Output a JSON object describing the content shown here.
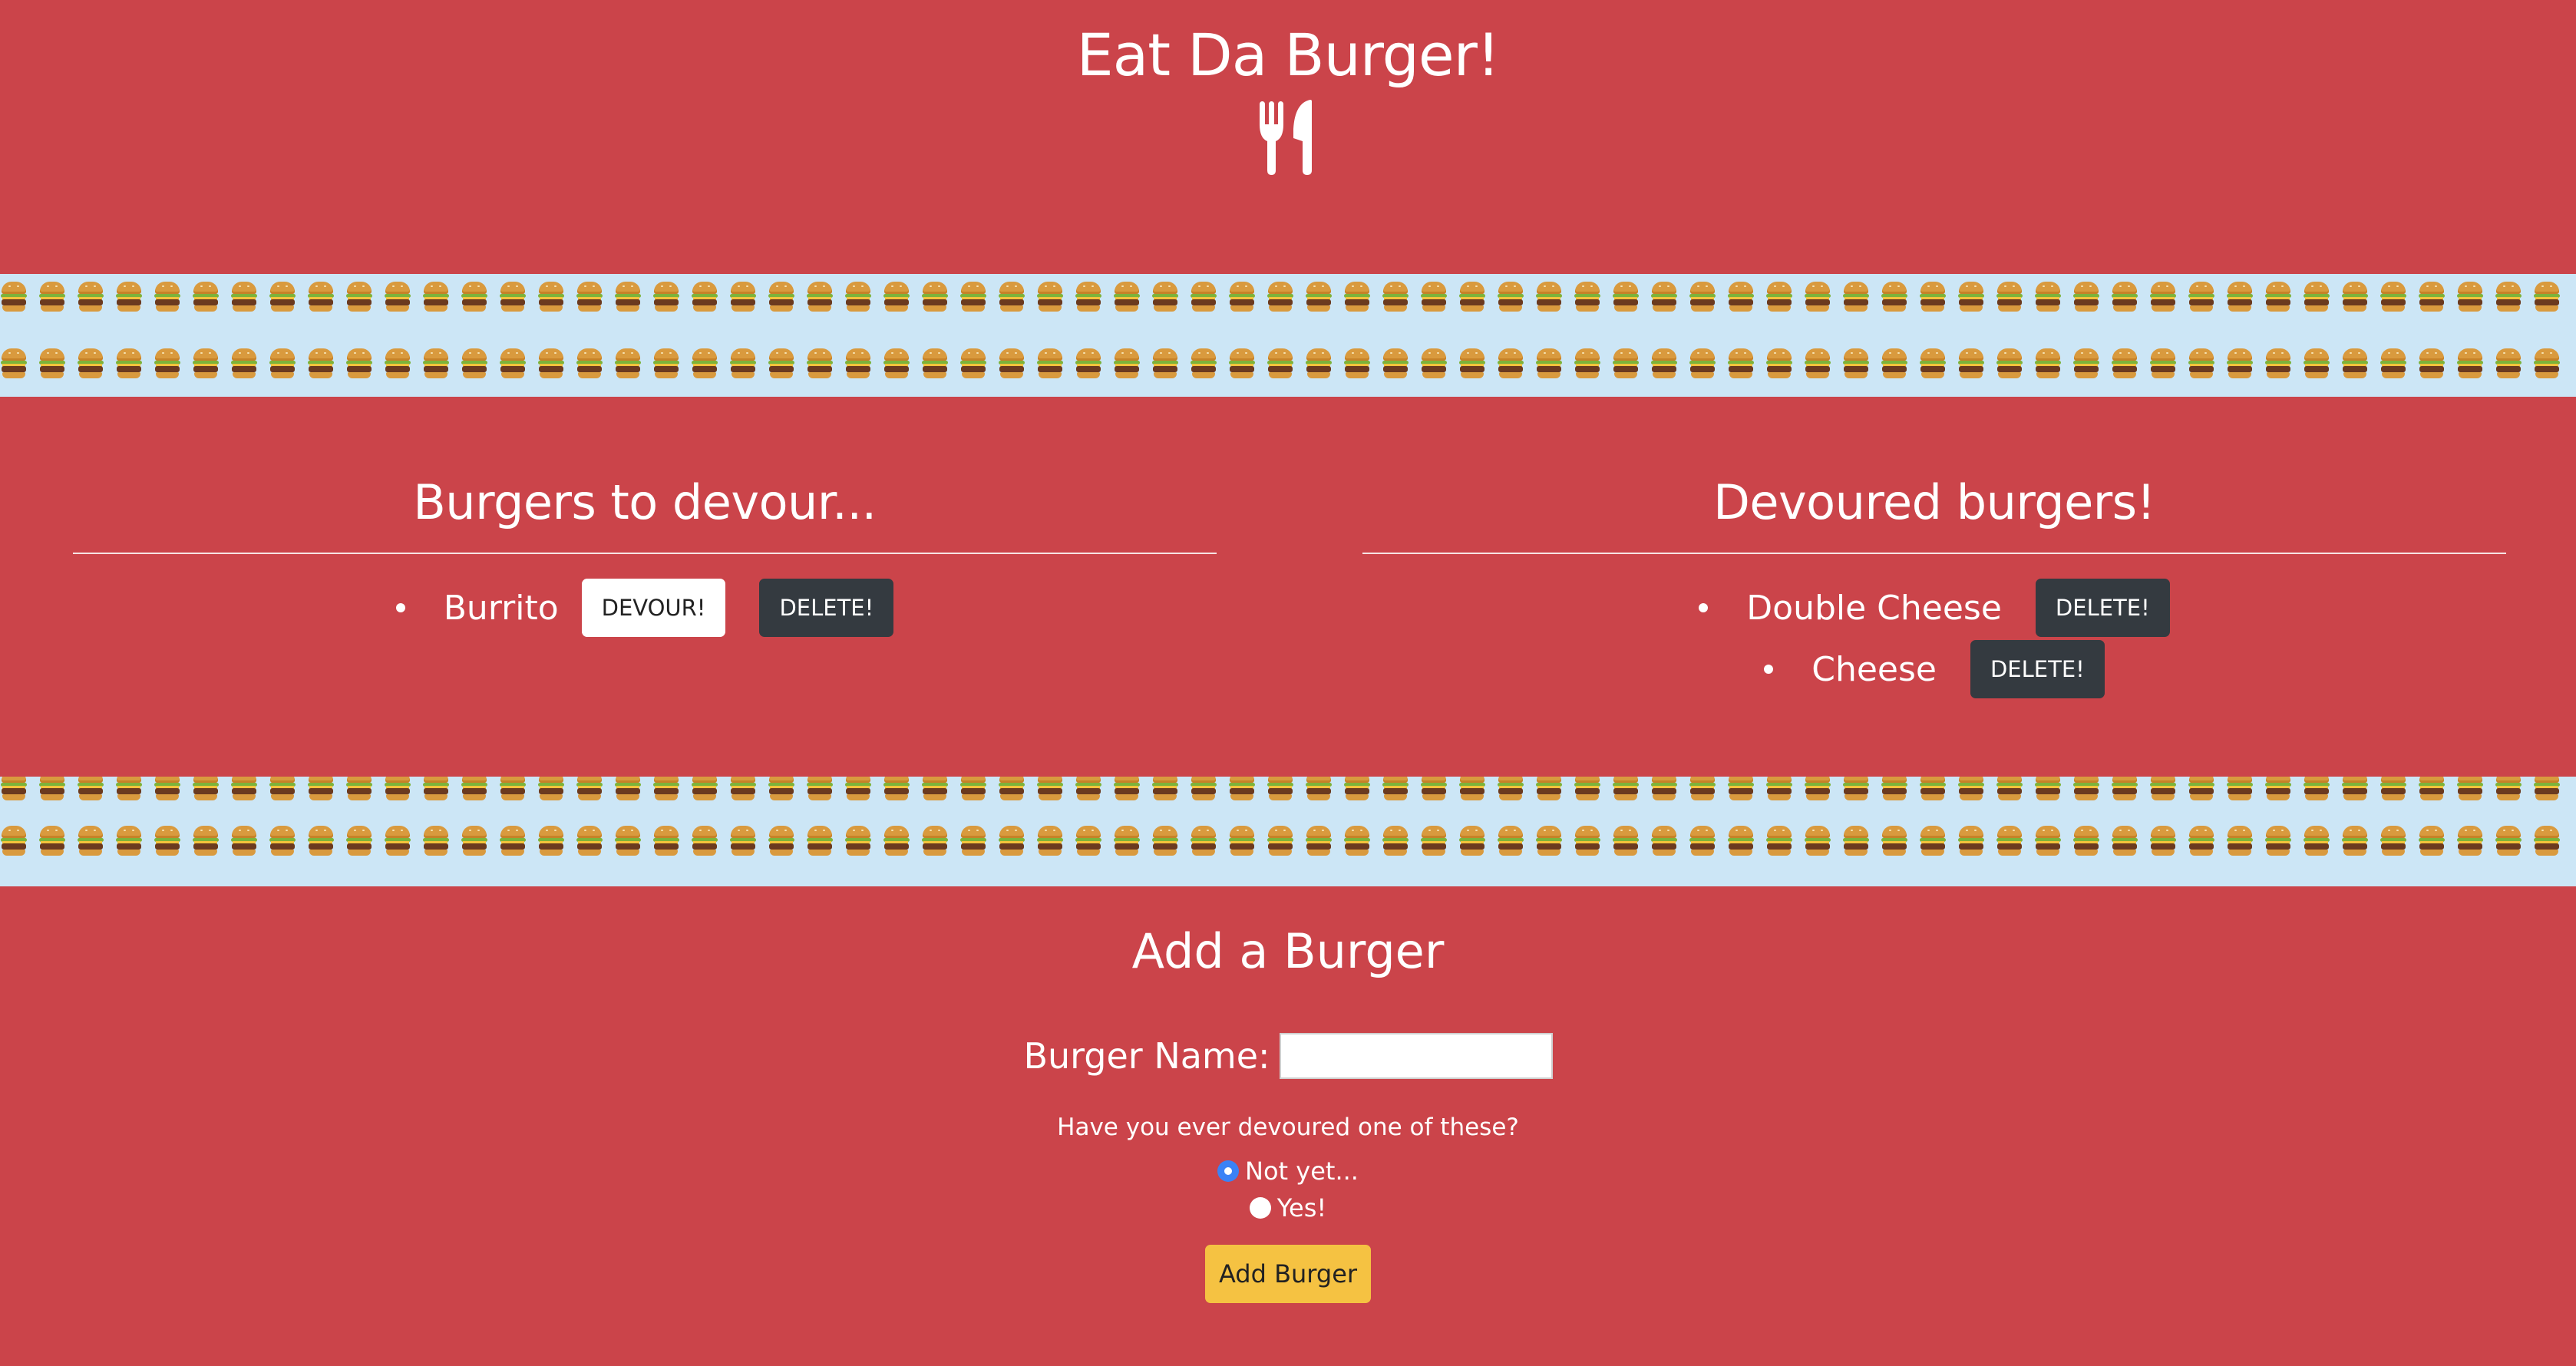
{
  "header": {
    "title": "Eat Da Burger!",
    "icon": "utensils-icon"
  },
  "columns": {
    "to_devour": {
      "title": "Burgers to devour...",
      "items": [
        {
          "name": "Burrito",
          "devour_label": "DEVOUR!",
          "delete_label": "DELETE!"
        }
      ]
    },
    "devoured": {
      "title": "Devoured burgers!",
      "items": [
        {
          "name": "Double Cheese",
          "delete_label": "DELETE!"
        },
        {
          "name": "Cheese",
          "delete_label": "DELETE!"
        }
      ]
    }
  },
  "add_form": {
    "title": "Add a Burger",
    "name_label": "Burger Name:",
    "name_value": "",
    "question": "Have you ever devoured one of these?",
    "options": [
      {
        "label": "Not yet...",
        "checked": true
      },
      {
        "label": "Yes!",
        "checked": false
      }
    ],
    "submit_label": "Add Burger"
  },
  "colors": {
    "primary_red": "#cb444a",
    "strip_blue": "#cce6f6",
    "dark_button": "#343a40",
    "submit_yellow": "#f5c242"
  }
}
